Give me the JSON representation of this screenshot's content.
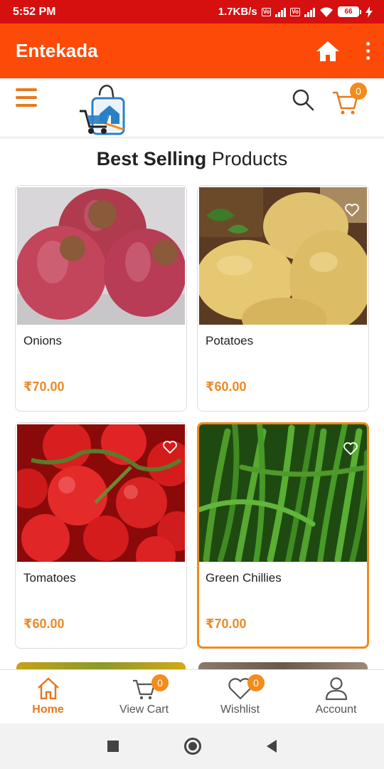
{
  "status_bar": {
    "time": "5:52 PM",
    "network_speed": "1.7KB/s",
    "sim1_tag": "Vo LTE",
    "sim1_network": "4G",
    "sim2_tag": "Vo LTE",
    "battery": "66"
  },
  "app_bar": {
    "title": "Entekada",
    "home_icon": "home-icon",
    "menu_icon": "more-vert-icon"
  },
  "header": {
    "menu_icon": "hamburger-icon",
    "logo": "shopping-bag-logo",
    "search_icon": "search-icon",
    "cart_icon": "cart-icon",
    "cart_count": "0"
  },
  "section": {
    "title_bold": "Best Selling",
    "title_rest": " Products"
  },
  "products": [
    {
      "name": "Onions",
      "price": "₹70.00"
    },
    {
      "name": "Potatoes",
      "price": "₹60.00"
    },
    {
      "name": "Tomatoes",
      "price": "₹60.00"
    },
    {
      "name": "Green Chillies",
      "price": "₹70.00"
    }
  ],
  "bottom_nav": {
    "items": [
      {
        "label": "Home",
        "icon": "home-outline-icon",
        "active": true
      },
      {
        "label": "View Cart",
        "icon": "cart-icon",
        "badge": "0"
      },
      {
        "label": "Wishlist",
        "icon": "heart-icon",
        "badge": "0"
      },
      {
        "label": "Account",
        "icon": "person-icon"
      }
    ]
  },
  "colors": {
    "status_bar": "#d60f0f",
    "app_bar": "#fc4b08",
    "accent": "#ec8a2a",
    "badge": "#f28c1c"
  }
}
